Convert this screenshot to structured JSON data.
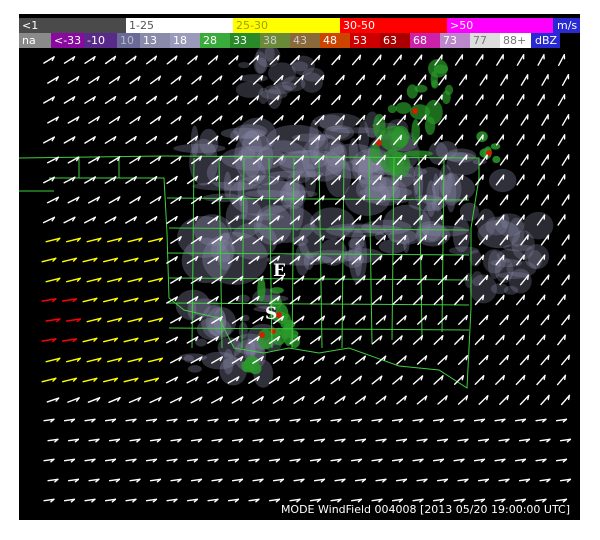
{
  "speed_legend": {
    "unit": "m/s",
    "bins": [
      {
        "label": "<1",
        "color": "#4a4a4a",
        "text_color": "#ffffff"
      },
      {
        "label": "1-25",
        "color": "#ffffff",
        "text_color": "#555555"
      },
      {
        "label": "25-30",
        "color": "#ffff00",
        "text_color": "#a0a000"
      },
      {
        "label": "30-50",
        "color": "#ff0000",
        "text_color": "#ffffff"
      },
      {
        "label": ">50",
        "color": "#ff00ff",
        "text_color": "#ffffff"
      }
    ]
  },
  "dbz_legend": {
    "unit": "dBZ",
    "bins": [
      {
        "label": "na",
        "color": "#8a8a8a",
        "text_color": "#ffffff"
      },
      {
        "label": "<-33",
        "color": "#8a0aa0",
        "text_color": "#ffffff"
      },
      {
        "label": "-10",
        "color": "#5a2a8a",
        "text_color": "#ffffff"
      },
      {
        "label": "10",
        "color": "#6a6a9a",
        "text_color": "#bbbbbb"
      },
      {
        "label": "13",
        "color": "#8a8aaa",
        "text_color": "#ffffff"
      },
      {
        "label": "18",
        "color": "#9a9aba",
        "text_color": "#ffffff"
      },
      {
        "label": "28",
        "color": "#3aaa3a",
        "text_color": "#ffffff"
      },
      {
        "label": "33",
        "color": "#2a8a2a",
        "text_color": "#ffffff"
      },
      {
        "label": "38",
        "color": "#6a8a3a",
        "text_color": "#cccccc"
      },
      {
        "label": "43",
        "color": "#8a6a3a",
        "text_color": "#cccccc"
      },
      {
        "label": "48",
        "color": "#cc4400",
        "text_color": "#ffffff"
      },
      {
        "label": "53",
        "color": "#cc0000",
        "text_color": "#ffffff"
      },
      {
        "label": "63",
        "color": "#aa0000",
        "text_color": "#ffffff"
      },
      {
        "label": "68",
        "color": "#cc22aa",
        "text_color": "#ffffff"
      },
      {
        "label": "73",
        "color": "#bb88cc",
        "text_color": "#ffffff"
      },
      {
        "label": "77",
        "color": "#dddddd",
        "text_color": "#777777"
      },
      {
        "label": "88+",
        "color": "#ffffff",
        "text_color": "#777777"
      }
    ]
  },
  "map_markers": {
    "e": "E",
    "s": "S"
  },
  "caption": "MODE WindField 004008 [2013 05/20 19:00:00 UTC]",
  "colors": {
    "background": "#000000",
    "border": "#5a0a0a",
    "county_lines": "#3ecf3e",
    "wind_default": "#ffffff",
    "wind_moderate": "#ffff00",
    "wind_strong": "#ff0000",
    "echo_light": "#8a8aaa",
    "echo_core_green": "#2a9a2a",
    "echo_core_red": "#cc2200"
  }
}
